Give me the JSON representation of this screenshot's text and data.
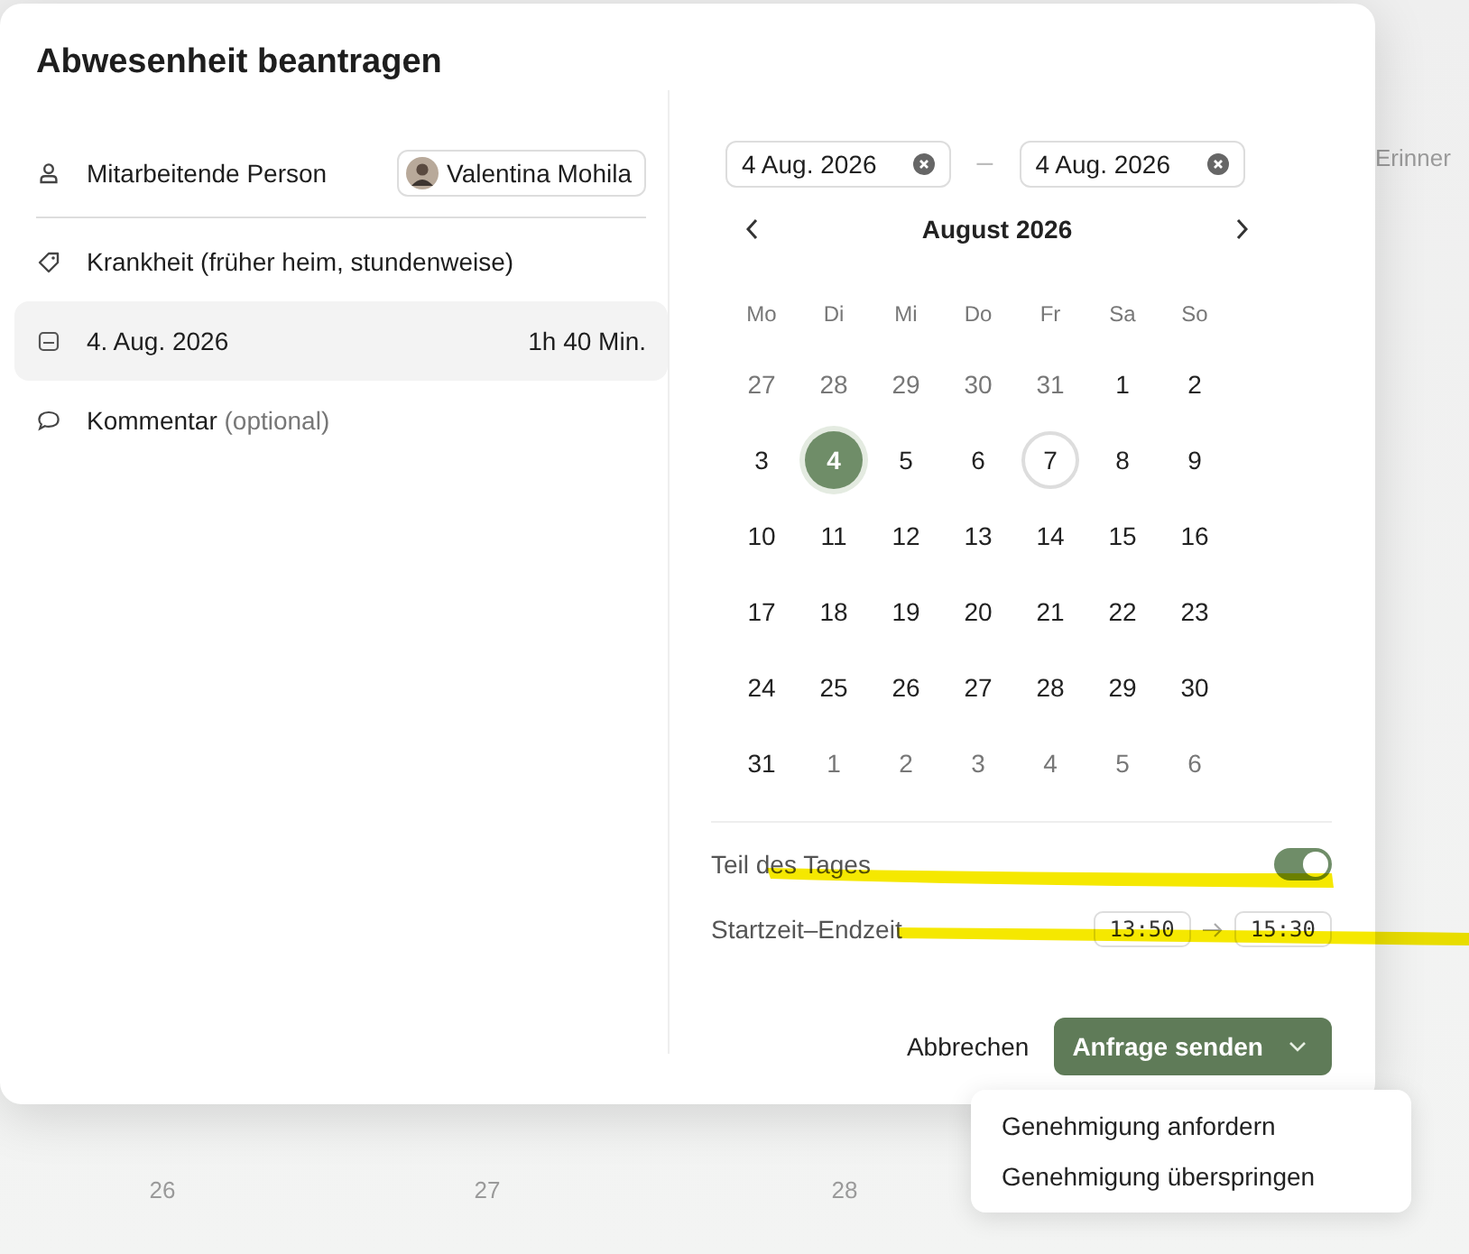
{
  "background": {
    "side_label": "Erinner",
    "day_numbers": [
      "26",
      "27",
      "28"
    ]
  },
  "dialog": {
    "title": "Abwesenheit beantragen",
    "fields": [
      {
        "kind": "person",
        "label": "Mitarbeitende Person",
        "value": "Valentina Mohila",
        "selected": false
      },
      {
        "kind": "category",
        "label": "Krankheit (früher heim, stundenweise)",
        "selected": false
      },
      {
        "kind": "date",
        "label": "4. Aug. 2026",
        "value": "1h 40 Min.",
        "selected": true
      },
      {
        "kind": "comment",
        "label": "Kommentar",
        "hint": "(optional)",
        "selected": false
      }
    ],
    "date_range": {
      "start": "4 Aug. 2026",
      "separator": "–",
      "end": "4 Aug. 2026"
    },
    "calendar": {
      "month": "August 2026",
      "weekdays": [
        "Mo",
        "Di",
        "Mi",
        "Do",
        "Fr",
        "Sa",
        "So"
      ],
      "weeks": [
        [
          {
            "day": "27",
            "outside": true,
            "selected": false,
            "today": false
          },
          {
            "day": "28",
            "outside": true,
            "selected": false,
            "today": false
          },
          {
            "day": "29",
            "outside": true,
            "selected": false,
            "today": false
          },
          {
            "day": "30",
            "outside": true,
            "selected": false,
            "today": false
          },
          {
            "day": "31",
            "outside": true,
            "selected": false,
            "today": false
          },
          {
            "day": "1",
            "outside": false,
            "selected": false,
            "today": false
          },
          {
            "day": "2",
            "outside": false,
            "selected": false,
            "today": false
          }
        ],
        [
          {
            "day": "3",
            "outside": false,
            "selected": false,
            "today": false
          },
          {
            "day": "4",
            "outside": false,
            "selected": true,
            "today": false
          },
          {
            "day": "5",
            "outside": false,
            "selected": false,
            "today": false
          },
          {
            "day": "6",
            "outside": false,
            "selected": false,
            "today": false
          },
          {
            "day": "7",
            "outside": false,
            "selected": false,
            "today": true
          },
          {
            "day": "8",
            "outside": false,
            "selected": false,
            "today": false
          },
          {
            "day": "9",
            "outside": false,
            "selected": false,
            "today": false
          }
        ],
        [
          {
            "day": "10",
            "outside": false,
            "selected": false,
            "today": false
          },
          {
            "day": "11",
            "outside": false,
            "selected": false,
            "today": false
          },
          {
            "day": "12",
            "outside": false,
            "selected": false,
            "today": false
          },
          {
            "day": "13",
            "outside": false,
            "selected": false,
            "today": false
          },
          {
            "day": "14",
            "outside": false,
            "selected": false,
            "today": false
          },
          {
            "day": "15",
            "outside": false,
            "selected": false,
            "today": false
          },
          {
            "day": "16",
            "outside": false,
            "selected": false,
            "today": false
          }
        ],
        [
          {
            "day": "17",
            "outside": false,
            "selected": false,
            "today": false
          },
          {
            "day": "18",
            "outside": false,
            "selected": false,
            "today": false
          },
          {
            "day": "19",
            "outside": false,
            "selected": false,
            "today": false
          },
          {
            "day": "20",
            "outside": false,
            "selected": false,
            "today": false
          },
          {
            "day": "21",
            "outside": false,
            "selected": false,
            "today": false
          },
          {
            "day": "22",
            "outside": false,
            "selected": false,
            "today": false
          },
          {
            "day": "23",
            "outside": false,
            "selected": false,
            "today": false
          }
        ],
        [
          {
            "day": "24",
            "outside": false,
            "selected": false,
            "today": false
          },
          {
            "day": "25",
            "outside": false,
            "selected": false,
            "today": false
          },
          {
            "day": "26",
            "outside": false,
            "selected": false,
            "today": false
          },
          {
            "day": "27",
            "outside": false,
            "selected": false,
            "today": false
          },
          {
            "day": "28",
            "outside": false,
            "selected": false,
            "today": false
          },
          {
            "day": "29",
            "outside": false,
            "selected": false,
            "today": false
          },
          {
            "day": "30",
            "outside": false,
            "selected": false,
            "today": false
          }
        ],
        [
          {
            "day": "31",
            "outside": false,
            "selected": false,
            "today": false
          },
          {
            "day": "1",
            "outside": true,
            "selected": false,
            "today": false
          },
          {
            "day": "2",
            "outside": true,
            "selected": false,
            "today": false
          },
          {
            "day": "3",
            "outside": true,
            "selected": false,
            "today": false
          },
          {
            "day": "4",
            "outside": true,
            "selected": false,
            "today": false
          },
          {
            "day": "5",
            "outside": true,
            "selected": false,
            "today": false
          },
          {
            "day": "6",
            "outside": true,
            "selected": false,
            "today": false
          }
        ]
      ]
    },
    "part_of_day": {
      "label": "Teil des Tages",
      "on": true
    },
    "time_range": {
      "label": "Startzeit–Endzeit",
      "start": "13:50",
      "end": "15:30"
    },
    "buttons": {
      "cancel": "Abbrechen",
      "submit": "Anfrage senden"
    }
  },
  "menu": {
    "items": [
      "Genehmigung anfordern",
      "Genehmigung überspringen"
    ]
  }
}
